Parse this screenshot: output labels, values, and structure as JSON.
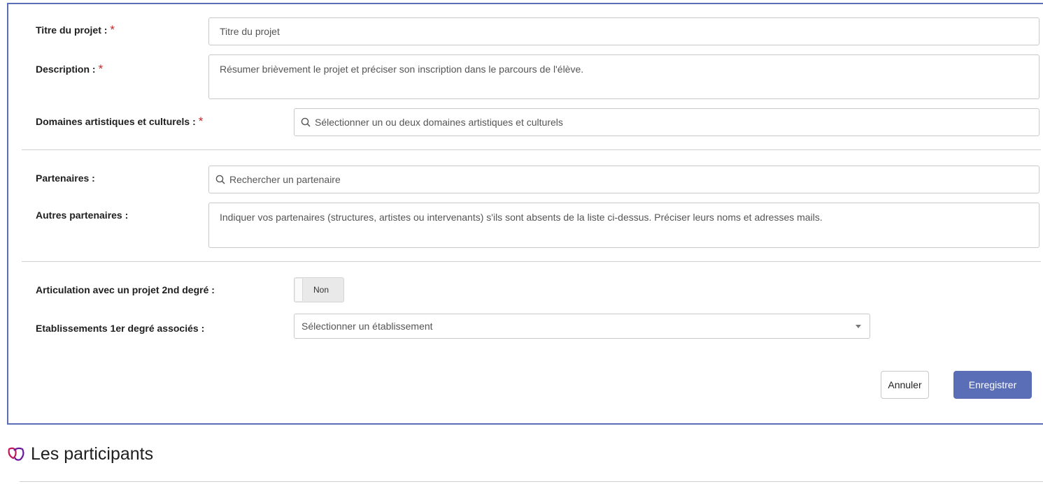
{
  "form": {
    "title": {
      "label": "Titre du projet :",
      "required": "*",
      "placeholder": "Titre du projet"
    },
    "description": {
      "label": "Description :",
      "required": "*",
      "placeholder": "Résumer brièvement le projet et préciser son inscription dans le parcours de l'élève."
    },
    "domains": {
      "label": "Domaines artistiques et culturels :",
      "required": "*",
      "placeholder": "Sélectionner un ou deux domaines artistiques et culturels",
      "icon": "search-icon"
    },
    "partners": {
      "label": "Partenaires :",
      "placeholder": "Rechercher un partenaire",
      "icon": "search-icon"
    },
    "other_partners": {
      "label": "Autres partenaires :",
      "placeholder": "Indiquer vos partenaires (structures, artistes ou intervenants) s'ils sont absents de la liste ci-dessus. Préciser leurs noms et adresses mails."
    },
    "articulation": {
      "label": "Articulation avec un projet 2nd degré :",
      "toggle_value": "Non"
    },
    "establishments": {
      "label": "Etablissements 1er degré associés :",
      "placeholder": "Sélectionner un établissement",
      "icon": "chevron-down-icon"
    }
  },
  "actions": {
    "cancel_label": "Annuler",
    "save_label": "Enregistrer"
  },
  "participants": {
    "title": "Les participants",
    "icon": "participants-logo-icon"
  },
  "colors": {
    "accent": "#5a6eb8",
    "required": "#c62828",
    "logo_pink": "#c2185b",
    "logo_purple": "#6a1b9a"
  }
}
